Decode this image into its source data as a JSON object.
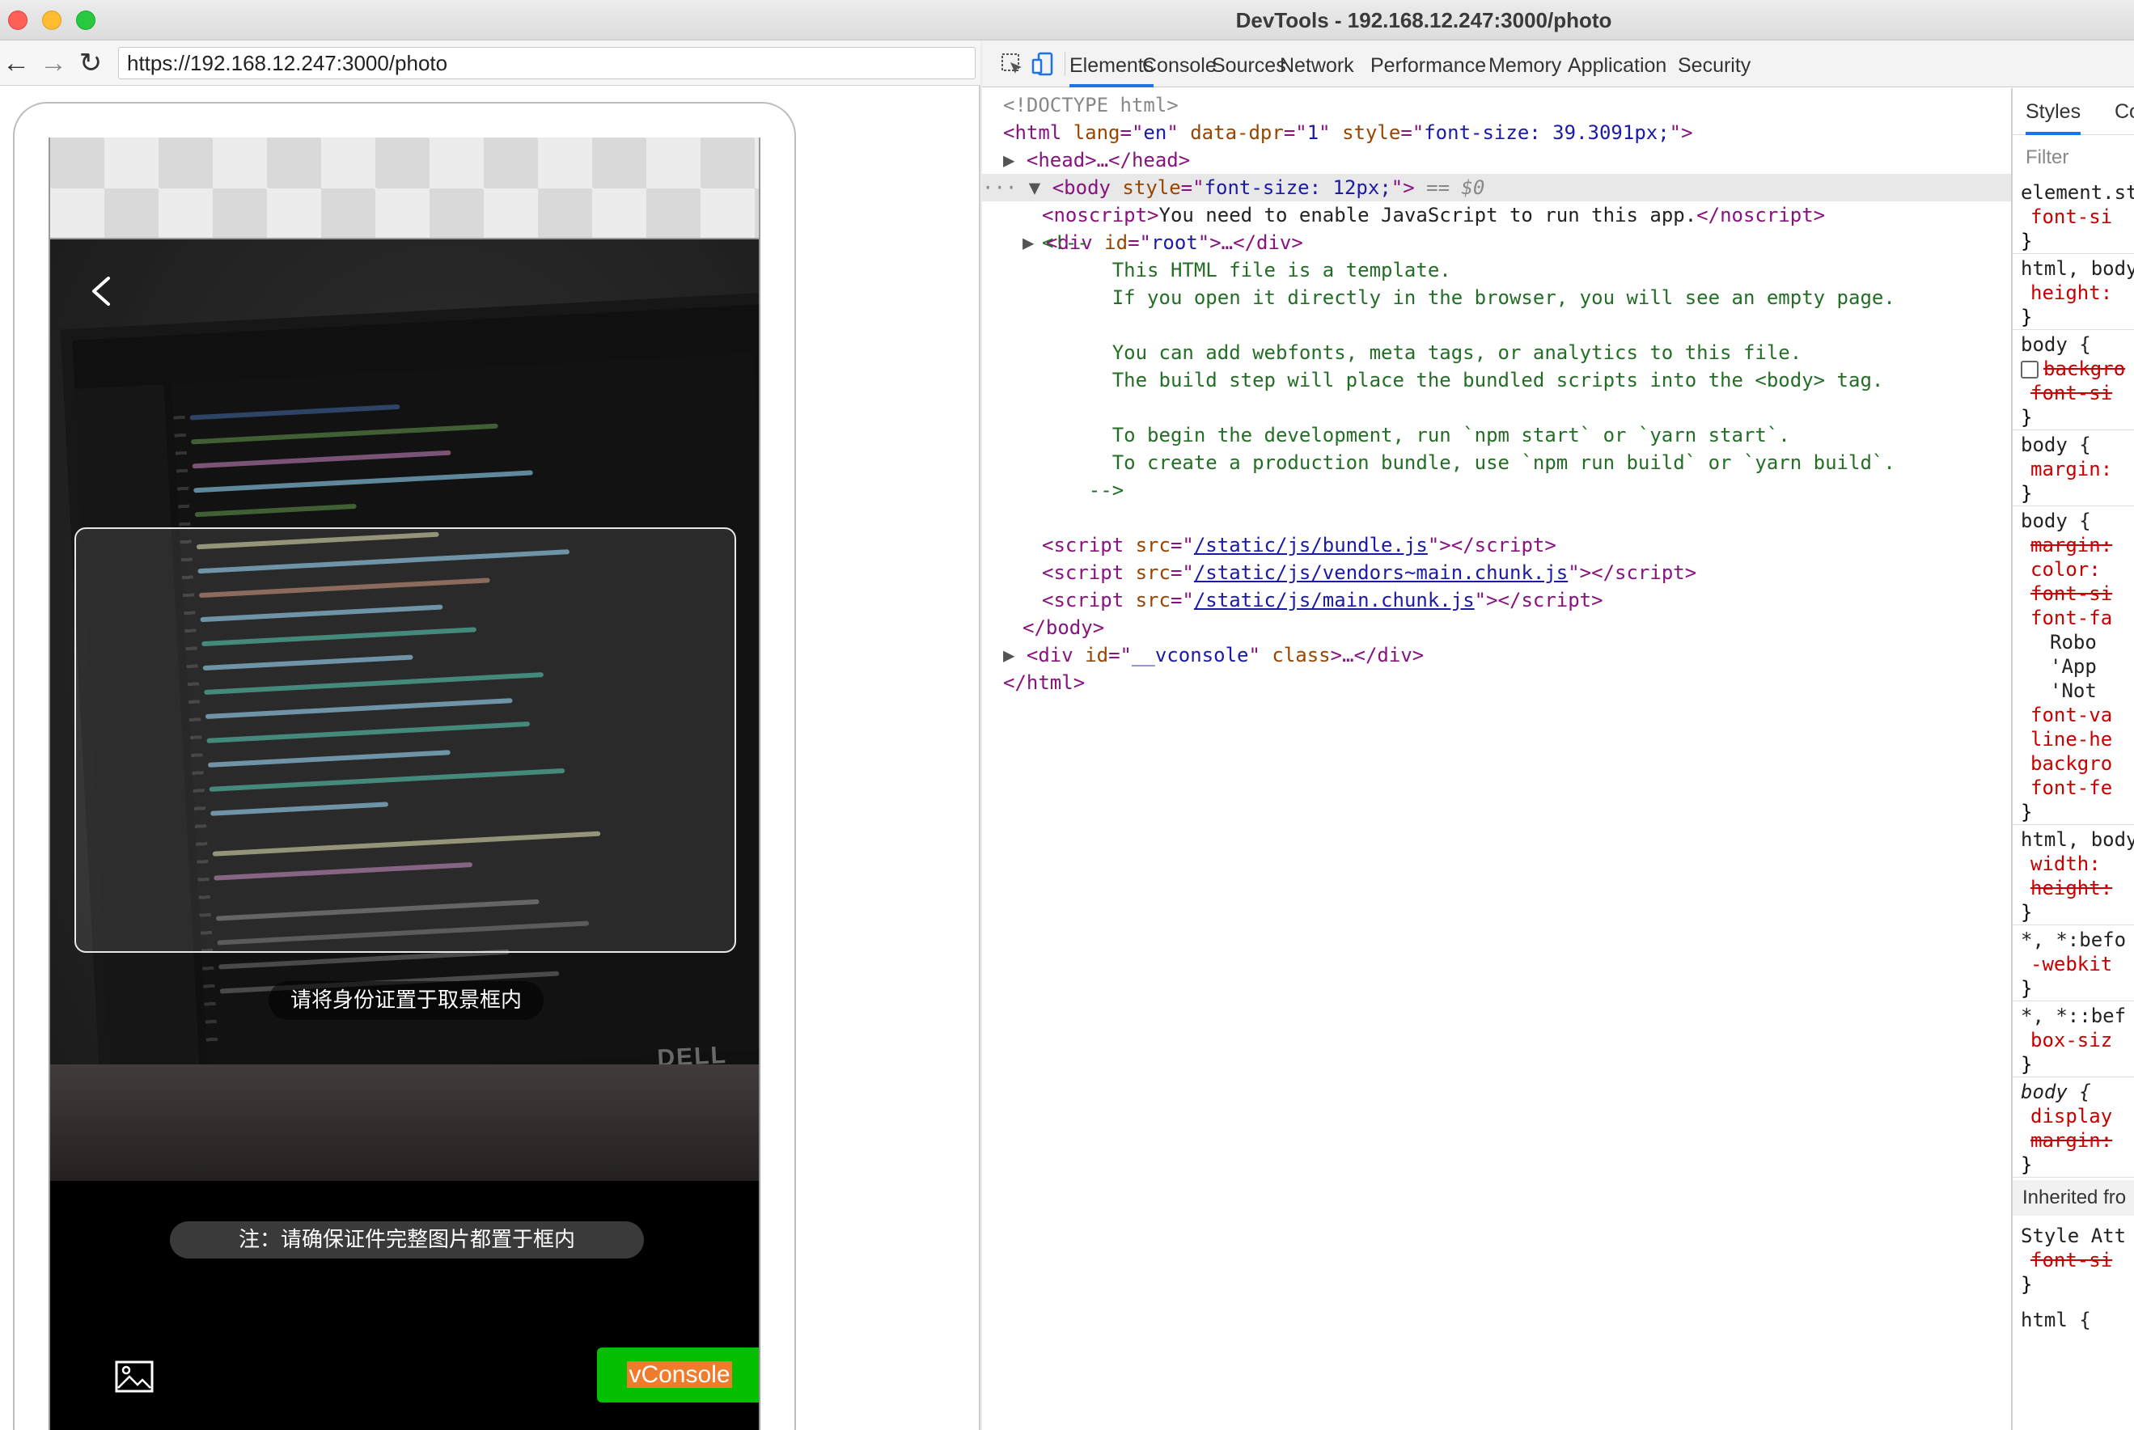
{
  "window": {
    "title": "DevTools - 192.168.12.247:3000/photo"
  },
  "browser": {
    "url": "https://192.168.12.247:3000/photo",
    "back_glyph": "←",
    "forward_glyph": "→",
    "reload_glyph": "↻"
  },
  "phone": {
    "hint_text": "请将身份证置于取景框内",
    "note_text": "注：请确保证件完整图片都置于框内",
    "vconsole_label": "vConsole",
    "dell_logo": "DELL"
  },
  "devtools": {
    "tabs": [
      "Elements",
      "Console",
      "Sources",
      "Network",
      "Performance",
      "Memory",
      "Application",
      "Security"
    ],
    "active_tab": "Elements",
    "dom": {
      "doctype": "<!DOCTYPE html>",
      "html_open": {
        "lang": "en",
        "dpr": "1",
        "style": "font-size: 39.3091px;"
      },
      "head": "<head>…</head>",
      "body_style": "font-size: 12px;",
      "body_marker": "== $0",
      "noscript": "You need to enable JavaScript to run this app.",
      "root_div": "root",
      "comment_lines": [
        "<!--",
        "      This HTML file is a template.",
        "      If you open it directly in the browser, you will see an empty page.",
        "",
        "      You can add webfonts, meta tags, or analytics to this file.",
        "      The build step will place the bundled scripts into the <body> tag.",
        "",
        "      To begin the development, run `npm start` or `yarn start`.",
        "      To create a production bundle, use `npm run build` or `yarn build`.",
        "    -->"
      ],
      "scripts": [
        "/static/js/bundle.js",
        "/static/js/vendors~main.chunk.js",
        "/static/js/main.chunk.js"
      ],
      "vconsole_id": "__vconsole",
      "body_close": "</body>",
      "html_close": "</html>"
    },
    "styles_pane": {
      "tabs": [
        "Styles",
        "Co"
      ],
      "filter_placeholder": "Filter",
      "inherited_label": "Inherited fro",
      "blocks": [
        {
          "selector": "element.st",
          "props": [
            "font-si"
          ]
        },
        {
          "selector": "html, body",
          "props": [
            "height:"
          ]
        },
        {
          "selector": "body {",
          "props": [
            "backgro",
            "font-si"
          ]
        },
        {
          "selector": "body {",
          "props": [
            "margin:"
          ]
        },
        {
          "selector": "body {",
          "props": [
            "margin:",
            "color:",
            "font-si",
            "font-fa",
            "Robo",
            "'App",
            "'Not",
            "font-va",
            "line-he",
            "backgro",
            "font-fe"
          ]
        },
        {
          "selector": "html, body",
          "props": [
            "width:",
            "height:"
          ]
        },
        {
          "selector": "*, *:befo",
          "props": [
            "-webkit"
          ]
        },
        {
          "selector": "*, *::bef",
          "props": [
            "box-siz"
          ]
        },
        {
          "selector": "body {",
          "props": [
            "display",
            "margin:"
          ]
        }
      ],
      "style_attr": {
        "selector": "Style Att",
        "props": [
          "font-si"
        ]
      },
      "last_selector": "html {"
    }
  }
}
